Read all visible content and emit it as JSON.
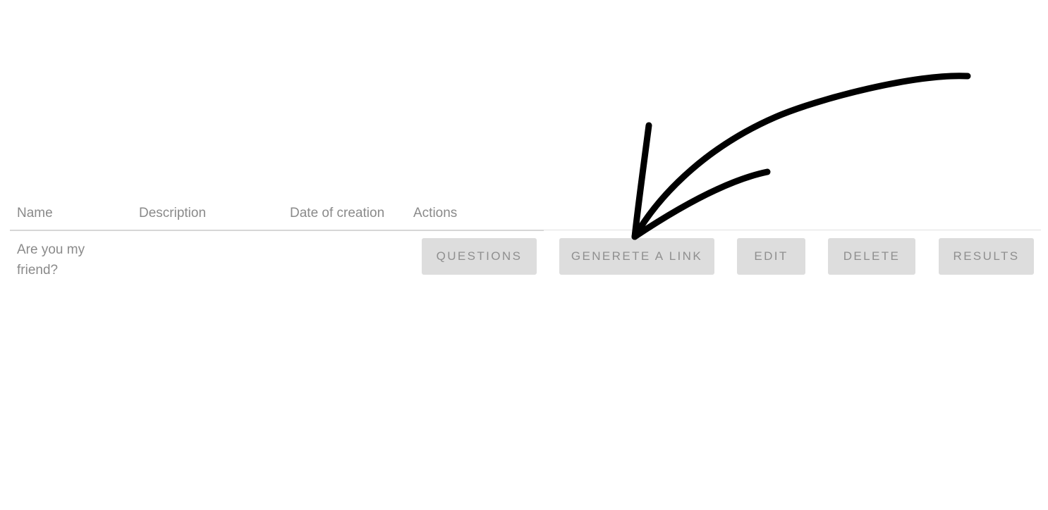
{
  "table": {
    "headers": {
      "name": "Name",
      "description": "Description",
      "date": "Date of creation",
      "actions": "Actions"
    },
    "rows": [
      {
        "name": "Are you my friend?",
        "description": "",
        "date": ""
      }
    ]
  },
  "actions": {
    "questions": "QUESTIONS",
    "generate_link": "GENERETE A LINK",
    "edit": "EDIT",
    "delete": "DELETE",
    "results": "RESULTS"
  },
  "colors": {
    "text_muted": "#8a8a8a",
    "button_bg": "#dddddd",
    "button_text": "#8f8f8f",
    "divider": "#d6d6d6",
    "annotation_stroke": "#000000"
  },
  "annotation": {
    "icon": "hand-drawn-arrow-icon"
  }
}
